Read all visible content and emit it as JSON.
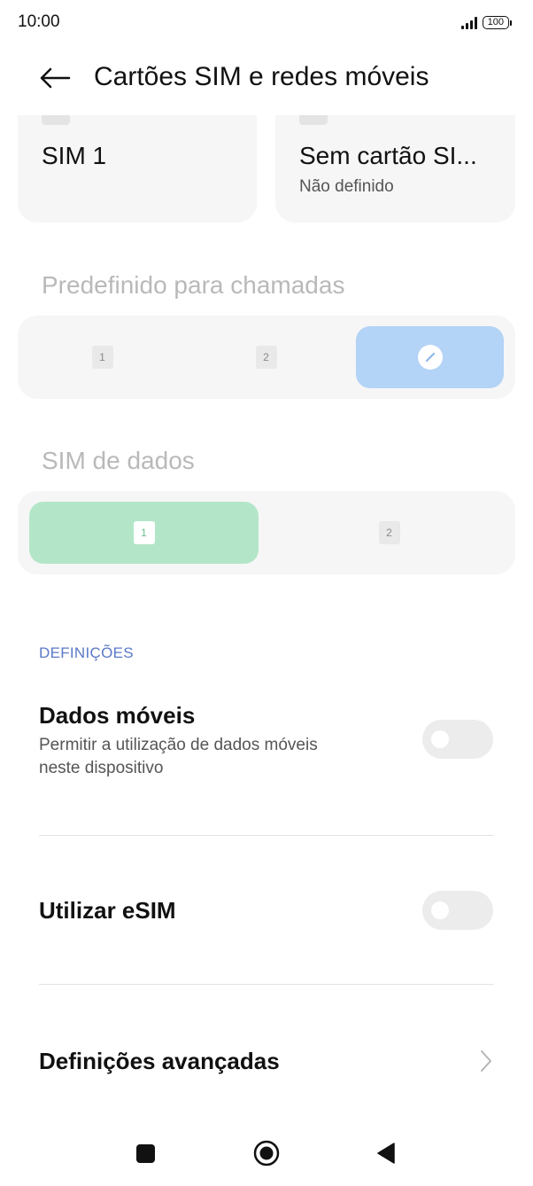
{
  "status_bar": {
    "time": "10:00",
    "battery": "100"
  },
  "header": {
    "title": "Cartões SIM e redes móveis"
  },
  "sim_cards": [
    {
      "name": "SIM 1",
      "status": ""
    },
    {
      "name": "Sem cartão SI...",
      "status": "Não definido"
    }
  ],
  "calls": {
    "title": "Predefinido para chamadas",
    "options": [
      "1",
      "2",
      "ask"
    ],
    "selected": "ask",
    "accent": "#b3d3f7"
  },
  "data_sim": {
    "title": "SIM de dados",
    "options": [
      "1",
      "2"
    ],
    "selected": "1",
    "accent": "#b3e6c8"
  },
  "settings": {
    "section_label": "DEFINIÇÕES",
    "mobile_data": {
      "title": "Dados móveis",
      "subtitle_line1": "Permitir a utilização de dados móveis",
      "subtitle_line2": "neste dispositivo",
      "enabled": false
    },
    "esim": {
      "title": "Utilizar eSIM",
      "enabled": false
    },
    "advanced": {
      "title": "Definições avançadas"
    }
  },
  "nav_bar": {
    "icons": [
      "recents-icon",
      "home-icon",
      "back-icon"
    ]
  }
}
